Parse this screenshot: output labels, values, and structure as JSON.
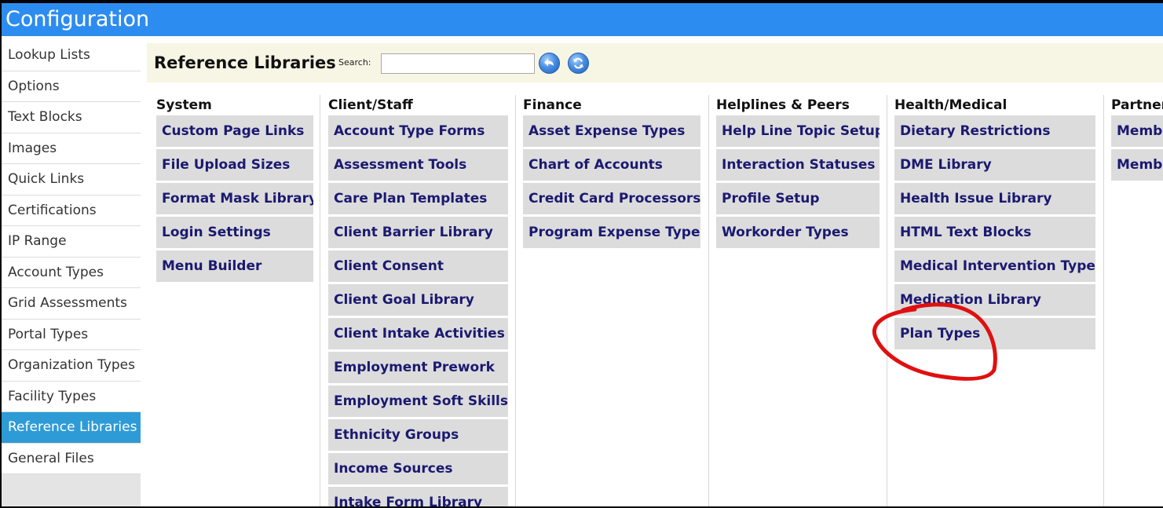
{
  "app": {
    "title": "Configuration"
  },
  "sidebar": {
    "items": [
      {
        "label": "Lookup Lists"
      },
      {
        "label": "Options"
      },
      {
        "label": "Text Blocks"
      },
      {
        "label": "Images"
      },
      {
        "label": "Quick Links"
      },
      {
        "label": "Certifications"
      },
      {
        "label": "IP Range"
      },
      {
        "label": "Account Types"
      },
      {
        "label": "Grid Assessments"
      },
      {
        "label": "Portal Types"
      },
      {
        "label": "Organization Types"
      },
      {
        "label": "Facility Types"
      },
      {
        "label": "Reference Libraries"
      },
      {
        "label": "General Files"
      }
    ],
    "active": "Reference Libraries"
  },
  "header": {
    "title": "Reference Libraries",
    "search_label": "Search:",
    "search_value": ""
  },
  "columns": [
    {
      "title": "System",
      "items": [
        "Custom Page Links",
        "File Upload Sizes",
        "Format Mask Library",
        "Login Settings",
        "Menu Builder"
      ]
    },
    {
      "title": "Client/Staff",
      "items": [
        "Account Type Forms",
        "Assessment Tools",
        "Care Plan Templates",
        "Client Barrier Library",
        "Client Consent",
        "Client Goal Library",
        "Client Intake Activities",
        "Employment Prework",
        "Employment Soft Skills",
        "Ethnicity Groups",
        "Income Sources",
        "Intake Form Library"
      ]
    },
    {
      "title": "Finance",
      "items": [
        "Asset Expense Types",
        "Chart of Accounts",
        "Credit Card Processors",
        "Program Expense Types"
      ]
    },
    {
      "title": "Helplines & Peers",
      "items": [
        "Help Line Topic Setup",
        "Interaction Statuses",
        "Profile Setup",
        "Workorder Types"
      ]
    },
    {
      "title": "Health/Medical",
      "items": [
        "Dietary Restrictions",
        "DME Library",
        "Health Issue Library",
        "HTML Text Blocks",
        "Medical Intervention Types",
        "Medication Library",
        "Plan Types"
      ]
    },
    {
      "title": "Partner",
      "items": [
        "Memb",
        "Memb"
      ]
    }
  ],
  "colors": {
    "titlebar": "#2d8cf0",
    "active_sidebar": "#2e9bd6",
    "link_text": "#1b1970",
    "button_bg": "#dcdcdc",
    "header_bg": "#f7f5e4",
    "annotation": "#e01010"
  },
  "icons": {
    "back": "back-arrow-icon",
    "refresh": "refresh-icon"
  }
}
